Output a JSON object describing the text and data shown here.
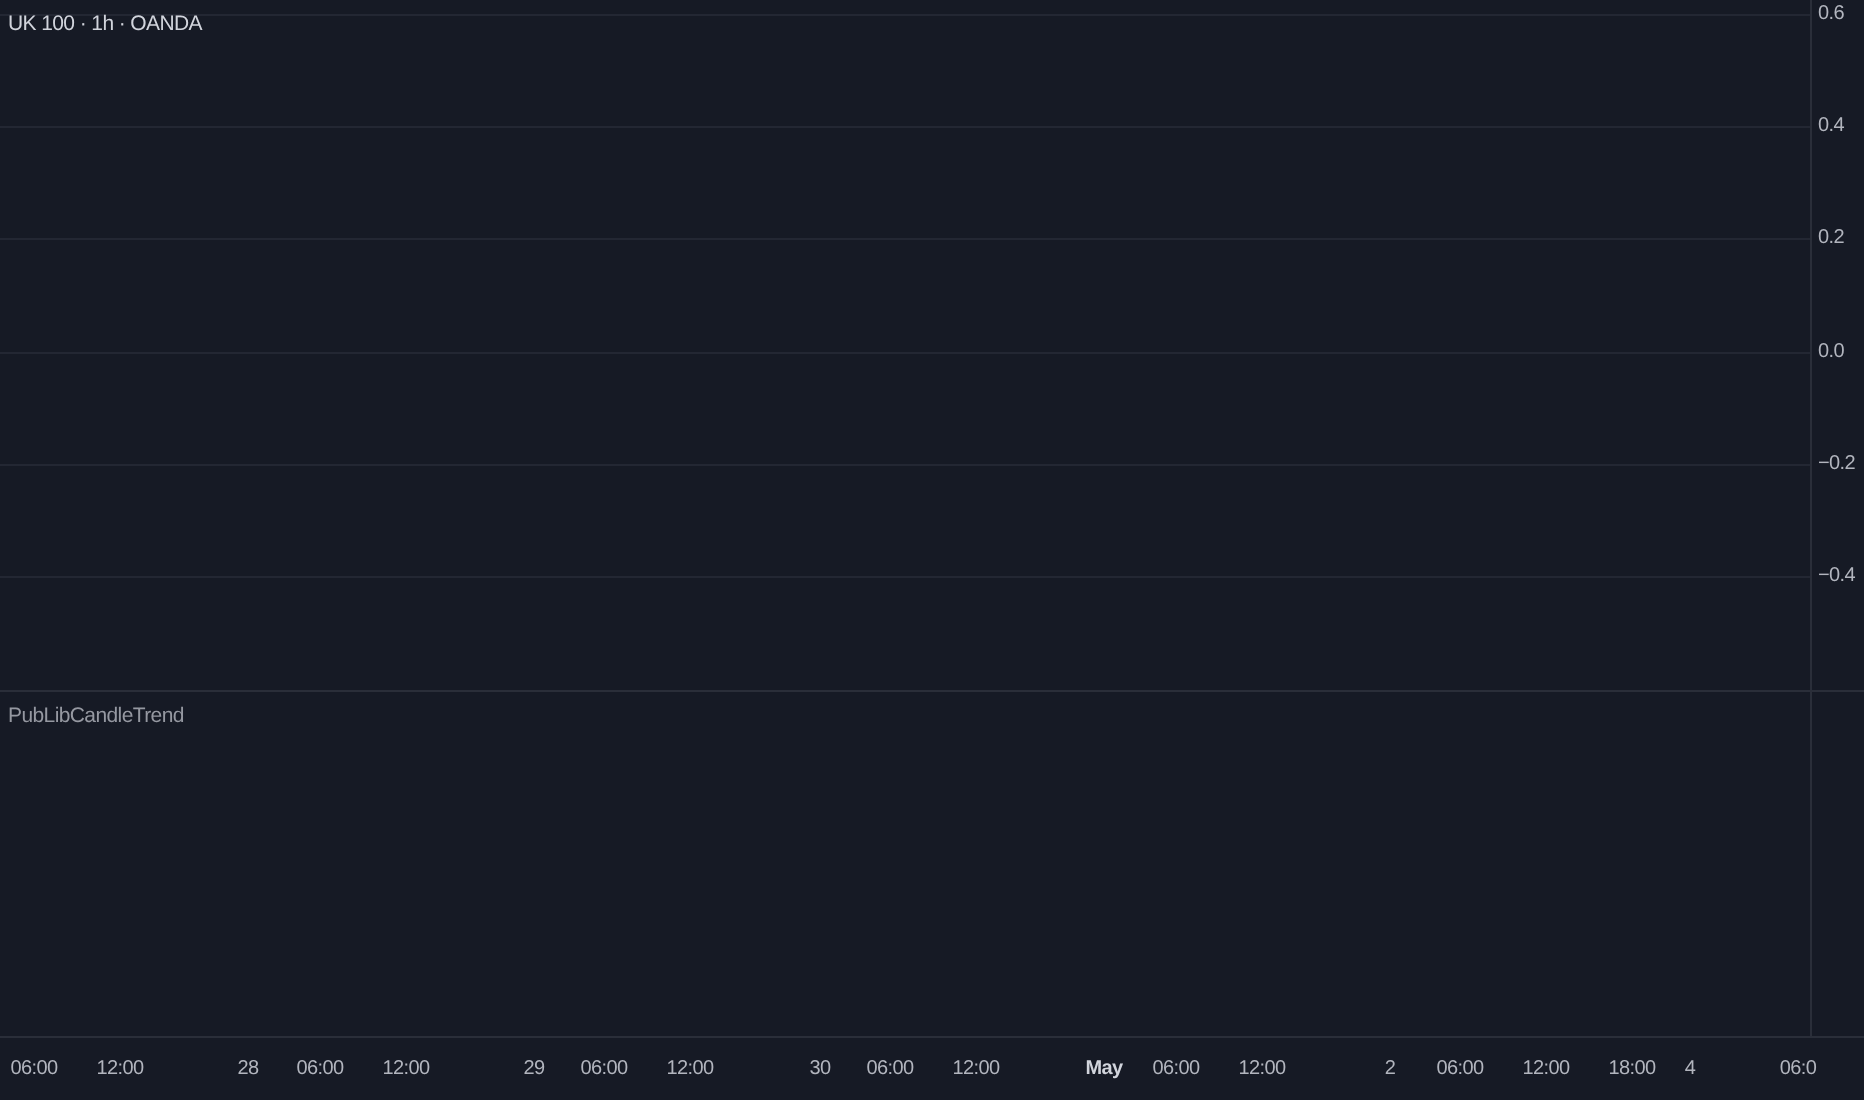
{
  "main_pane": {
    "legend": "UK 100 · 1h · OANDA",
    "price_axis": [
      "0.6",
      "0.4",
      "0.2",
      "0.0",
      "−0.2",
      "−0.4"
    ]
  },
  "indicator_pane": {
    "legend": "PubLibCandleTrend"
  },
  "time_axis": [
    {
      "label": "06:00",
      "bold": false
    },
    {
      "label": "12:00",
      "bold": false
    },
    {
      "label": "28",
      "bold": false
    },
    {
      "label": "06:00",
      "bold": false
    },
    {
      "label": "12:00",
      "bold": false
    },
    {
      "label": "29",
      "bold": false
    },
    {
      "label": "06:00",
      "bold": false
    },
    {
      "label": "12:00",
      "bold": false
    },
    {
      "label": "30",
      "bold": false
    },
    {
      "label": "06:00",
      "bold": false
    },
    {
      "label": "12:00",
      "bold": false
    },
    {
      "label": "May",
      "bold": true
    },
    {
      "label": "06:00",
      "bold": false
    },
    {
      "label": "12:00",
      "bold": false
    },
    {
      "label": "2",
      "bold": false
    },
    {
      "label": "06:00",
      "bold": false
    },
    {
      "label": "12:00",
      "bold": false
    },
    {
      "label": "18:00",
      "bold": false
    },
    {
      "label": "4",
      "bold": false
    },
    {
      "label": "06:0",
      "bold": false
    }
  ]
}
